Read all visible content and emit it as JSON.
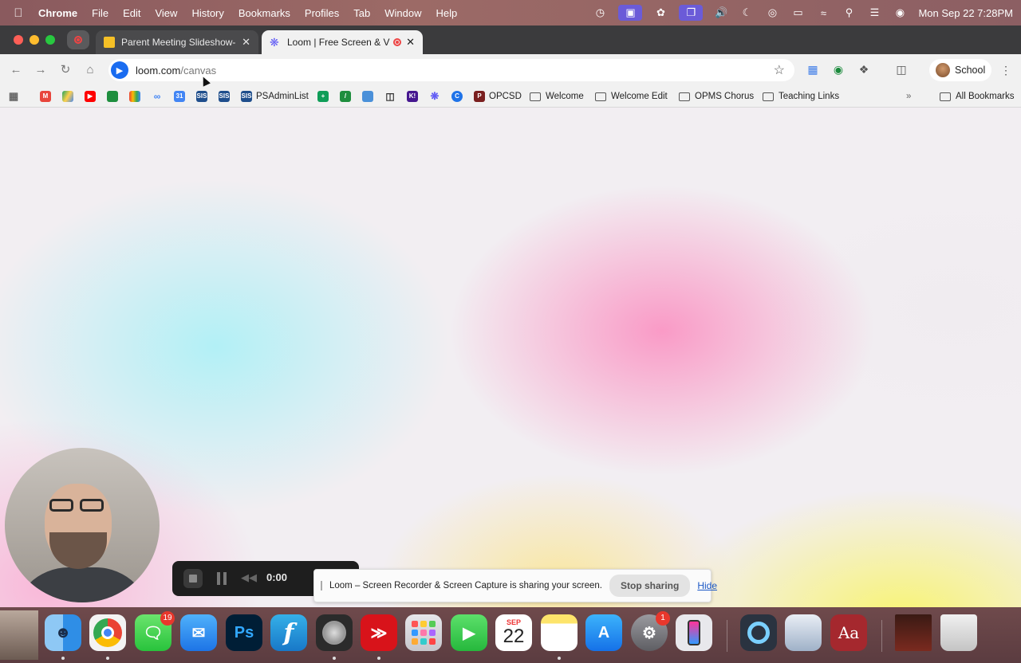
{
  "menubar": {
    "app_name": "Chrome",
    "menus": [
      "File",
      "Edit",
      "View",
      "History",
      "Bookmarks",
      "Profiles",
      "Tab",
      "Window",
      "Help"
    ],
    "clock": "Mon Sep 22  7:28PM"
  },
  "tabs": [
    {
      "title": "Parent Meeting Slideshow- Bu",
      "active": false
    },
    {
      "title": "Loom | Free Screen & Vid",
      "active": true
    }
  ],
  "omnibox": {
    "domain": "loom.com",
    "path": "/canvas"
  },
  "profile": {
    "label": "School"
  },
  "bookmarks": {
    "labeled": [
      "PSAdminList",
      "OPCSD",
      "Welcome",
      "Welcome Edit",
      "OPMS Chorus",
      "Teaching Links"
    ],
    "all_bookmarks": "All Bookmarks",
    "sis_label": "SIS",
    "cal_label": "31",
    "k_label": "K!"
  },
  "recording": {
    "timer": "0:00"
  },
  "share_banner": {
    "text": "Loom – Screen Recorder & Screen Capture is sharing your screen.",
    "stop_label": "Stop sharing",
    "hide_label": "Hide"
  },
  "dock": {
    "messages_badge": "19",
    "settings_badge": "1",
    "calendar_month": "SEP",
    "calendar_day": "22",
    "photoshop_label": "Ps",
    "dictionary_label": "Aa"
  }
}
